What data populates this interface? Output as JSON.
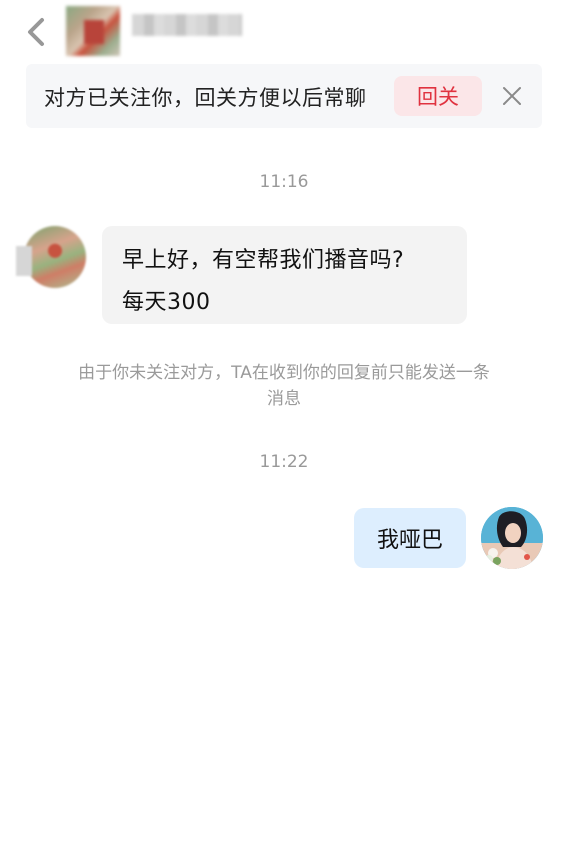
{
  "header": {
    "back_icon": "back-arrow-icon",
    "contact_name": ""
  },
  "follow_notice": {
    "text": "对方已关注你，回关方便以后常聊",
    "button_label": "回关",
    "button_color": "#e0323f",
    "close_icon": "close-icon"
  },
  "messages": [
    {
      "time": "11:16",
      "direction": "incoming",
      "lines": [
        "早上好，有空帮我们播音吗?",
        "每天300"
      ]
    },
    {
      "notice_lines": [
        "由于你未关注对方，TA在收到你的回复前只能发送一条",
        "消息"
      ]
    },
    {
      "time": "11:22",
      "direction": "outgoing",
      "lines": [
        "我哑巴"
      ]
    }
  ],
  "colors": {
    "outgoing_bubble": "#ddeefe",
    "incoming_bubble": "#f3f3f3",
    "notice_text": "#9a9a9a"
  }
}
